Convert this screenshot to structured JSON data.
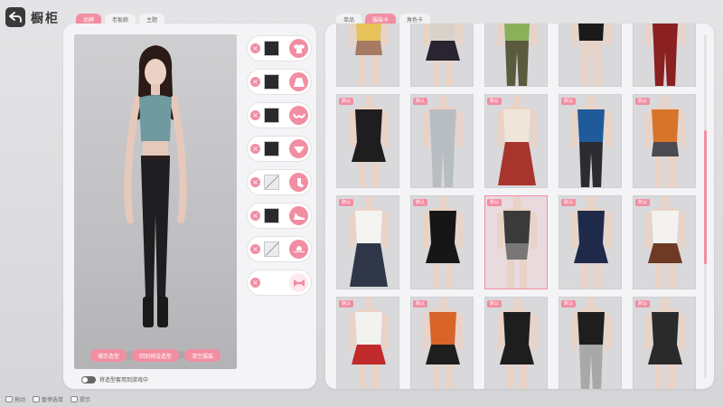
{
  "header": {
    "title": "橱柜"
  },
  "left_tabs": [
    "品牌",
    "老板娘",
    "主题"
  ],
  "right_tabs": [
    "单品",
    "服装卡",
    "角色卡"
  ],
  "preview": {
    "actions": [
      "储存造型",
      "回到预设造型",
      "清空服装"
    ]
  },
  "slots": [
    {
      "name": "top",
      "icon": "tshirt-icon",
      "state": "filled"
    },
    {
      "name": "skirt",
      "icon": "skirt-icon",
      "state": "filled"
    },
    {
      "name": "bra",
      "icon": "bra-icon",
      "state": "filled"
    },
    {
      "name": "panties",
      "icon": "panties-icon",
      "state": "filled"
    },
    {
      "name": "socks",
      "icon": "sock-icon",
      "state": "empty"
    },
    {
      "name": "shoes",
      "icon": "heel-icon",
      "state": "filled"
    },
    {
      "name": "hat",
      "icon": "hat-icon",
      "state": "empty"
    },
    {
      "name": "accessory",
      "icon": "bow-icon",
      "state": "none"
    }
  ],
  "toggle_label": "将造型套用到游戏中",
  "badge_label": "默认",
  "outfits": [
    {
      "top": "#e8c25a",
      "bottom": "#a77b63",
      "skin": "#e9d2c6",
      "style": "shorts",
      "badge": false
    },
    {
      "top": "#d9d2c8",
      "bottom": "#2a2330",
      "skin": "#e9d2c6",
      "style": "skirt",
      "badge": false
    },
    {
      "top": "#8cb05a",
      "bottom": "#5a5a3e",
      "skin": "#e9d2c6",
      "style": "pants",
      "badge": false
    },
    {
      "top": "#1a1a1a",
      "bottom": "#e9d2c6",
      "skin": "#e9d2c6",
      "style": "lingerie",
      "badge": false
    },
    {
      "top": "#8a2020",
      "bottom": "#8a2020",
      "skin": "#e9d2c6",
      "style": "pants",
      "badge": false
    },
    {
      "top": "#1e1e1e",
      "bottom": "#1e1e1e",
      "skin": "#e9d2c6",
      "style": "skirt",
      "badge": true
    },
    {
      "top": "#b8bdc2",
      "bottom": "#b8bdc2",
      "skin": "#e9d2c6",
      "style": "pants",
      "badge": true
    },
    {
      "top": "#efe5d8",
      "bottom": "#a8352c",
      "skin": "#e9d2c6",
      "style": "long-skirt",
      "badge": true
    },
    {
      "top": "#1f5a9a",
      "bottom": "#2c2c30",
      "skin": "#e9d2c6",
      "style": "pants",
      "badge": true
    },
    {
      "top": "#d8742a",
      "bottom": "#4a4a50",
      "skin": "#e9d2c6",
      "style": "shorts",
      "badge": true
    },
    {
      "top": "#f4f4f2",
      "bottom": "#2e3648",
      "skin": "#e9d2c6",
      "style": "long-skirt",
      "badge": true
    },
    {
      "top": "#161616",
      "bottom": "#161616",
      "skin": "#e9d2c6",
      "style": "skirt",
      "badge": true
    },
    {
      "top": "#3a3a3a",
      "bottom": "#5c5c5c",
      "skin": "#e9d2c6",
      "style": "lingerie",
      "badge": true,
      "selected": true
    },
    {
      "top": "#1f2a4a",
      "bottom": "#1f2a4a",
      "skin": "#e9d2c6",
      "style": "skirt",
      "badge": true
    },
    {
      "top": "#f4f2ee",
      "bottom": "#6e3a24",
      "skin": "#e9d2c6",
      "style": "skirt",
      "badge": true
    },
    {
      "top": "#f2f2f0",
      "bottom": "#c12a2a",
      "skin": "#e9d2c6",
      "style": "skirt",
      "badge": true
    },
    {
      "top": "#d8642a",
      "bottom": "#1e1e1e",
      "skin": "#e9d2c6",
      "style": "skirt",
      "badge": true
    },
    {
      "top": "#1e1e1e",
      "bottom": "#1e1e1e",
      "skin": "#e9d2c6",
      "style": "skirt",
      "badge": true
    },
    {
      "top": "#1e1e1e",
      "bottom": "#a8a8a8",
      "skin": "#e9d2c6",
      "style": "pants",
      "badge": true
    },
    {
      "top": "#2a2a2a",
      "bottom": "#2a2a2a",
      "skin": "#e9d2c6",
      "style": "skirt",
      "badge": true
    }
  ],
  "hints": [
    {
      "key": "拖动"
    },
    {
      "key": "暂停选单"
    },
    {
      "key": "提示"
    }
  ],
  "colors": {
    "accent": "#f28da2",
    "panel": "#f4f4f6"
  }
}
